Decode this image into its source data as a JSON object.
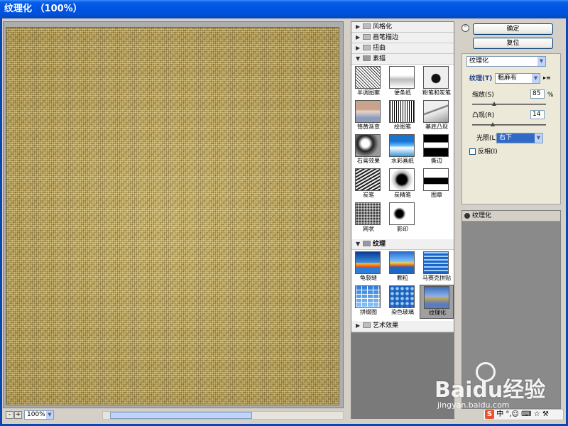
{
  "window": {
    "title": "纹理化 （100%）"
  },
  "preview": {
    "zoom": "100%",
    "zoom_out": "-",
    "zoom_in": "+"
  },
  "gallery": {
    "categories_top": [
      "风格化",
      "画笔描边",
      "扭曲"
    ],
    "sketch": {
      "name": "素描",
      "filters": [
        "半调图案",
        "便条纸",
        "粉笔和炭笔",
        "铬黄渐变",
        "绘图笔",
        "基底凸现",
        "石膏效果",
        "水彩画纸",
        "撕边",
        "炭笔",
        "炭精笔",
        "图章",
        "网状",
        "影印"
      ]
    },
    "texture": {
      "name": "纹理",
      "filters": [
        "龟裂缝",
        "颗粒",
        "马赛克拼贴",
        "拼缀图",
        "染色玻璃",
        "纹理化"
      ],
      "selected": "纹理化"
    },
    "categories_bottom": [
      "艺术效果"
    ]
  },
  "buttons": {
    "ok": "确定",
    "reset": "复位"
  },
  "settings": {
    "filter_select": "纹理化",
    "texture_label": "纹理(T)",
    "texture_value": "粗麻布",
    "scaling_label": "缩放(S)",
    "scaling_value": "85",
    "scaling_unit": "%",
    "scaling_level": 0.3,
    "relief_label": "凸现(R)",
    "relief_value": "14",
    "relief_level": 0.28,
    "light_label": "光照(L):",
    "light_value": "右下",
    "invert_label": "反相(I)",
    "invert_checked": false
  },
  "layers": {
    "items": [
      "纹理化"
    ]
  },
  "watermark": {
    "brand_main": "Baidu经验",
    "brand_sub": "jingyan.baidu.com"
  },
  "tray": {
    "text": "中 °,☺ ⌨ ☆ ⚒"
  },
  "colors": {
    "title_bar": "#0054E3",
    "selection": "#316AC5",
    "preview": "#B8A25E"
  }
}
